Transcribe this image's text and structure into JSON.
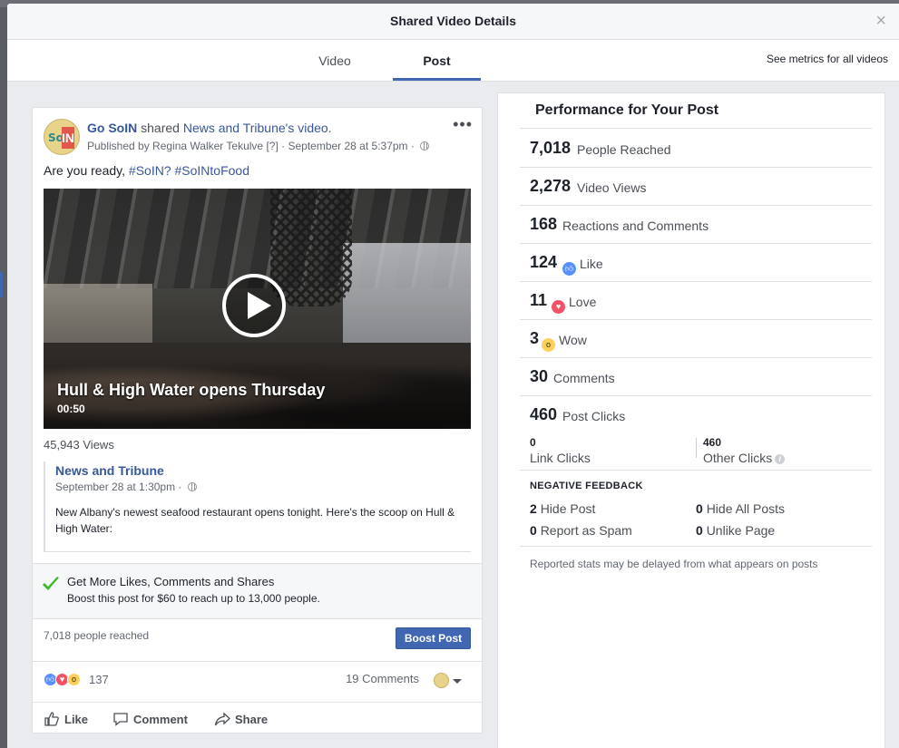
{
  "dialog": {
    "title": "Shared Video Details",
    "close": "×",
    "tabs": [
      {
        "label": "Video"
      },
      {
        "label": "Post",
        "active": true
      }
    ],
    "see_metrics": "See metrics for all videos"
  },
  "post": {
    "page_name": "Go SoIN",
    "shared_text": "shared",
    "source_name": "News and Tribune",
    "source_suffix": "'s video.",
    "published_by": "Published by Regina Walker Tekulve",
    "published_help": "[?]",
    "published_date": "· September 28 at 5:37pm ·",
    "message_prefix": "Are you ready,",
    "hashtag1": "#SoIN?",
    "hashtag2": "#SoINtoFood",
    "video": {
      "title": "Hull & High Water opens Thursday",
      "duration": "00:50"
    },
    "views": "45,943 Views",
    "original": {
      "name": "News and Tribune",
      "date": "September 28 at 1:30pm ·",
      "description": "New Albany's newest seafood restaurant opens tonight. Here's the scoop on Hull & High Water:"
    },
    "boost_promo": {
      "title": "Get More Likes, Comments and Shares",
      "subtitle": "Boost this post for $60 to reach up to 13,000 people."
    },
    "reached": "7,018 people reached",
    "boost_button": "Boost Post",
    "reactions_count": "137",
    "comments_count": "19 Comments",
    "actions": {
      "like": "Like",
      "comment": "Comment",
      "share": "Share"
    }
  },
  "performance": {
    "title": "Performance for Your Post",
    "metrics": [
      {
        "value": "7,018",
        "label": "People Reached"
      },
      {
        "value": "2,278",
        "label": "Video Views"
      },
      {
        "value": "168",
        "label": "Reactions and Comments"
      },
      {
        "value": "124",
        "label": "Like",
        "icon": "like-icon"
      },
      {
        "value": "11",
        "label": "Love",
        "icon": "love-icon"
      },
      {
        "value": "3",
        "label": "Wow",
        "icon": "wow-icon"
      },
      {
        "value": "30",
        "label": "Comments"
      },
      {
        "value": "460",
        "label": "Post Clicks"
      }
    ],
    "link_clicks": {
      "value": "0",
      "label": "Link Clicks"
    },
    "other_clicks": {
      "value": "460",
      "label": "Other Clicks"
    },
    "negative": {
      "title": "NEGATIVE FEEDBACK",
      "hide_post": {
        "value": "2",
        "label": "Hide Post"
      },
      "hide_all": {
        "value": "0",
        "label": "Hide All Posts"
      },
      "report_spam": {
        "value": "0",
        "label": "Report as Spam"
      },
      "unlike_page": {
        "value": "0",
        "label": "Unlike Page"
      }
    },
    "note": "Reported stats may be delayed from what appears on posts"
  },
  "colors": {
    "accent": "#4267b2",
    "link": "#365899",
    "like": "#5890ff",
    "love": "#f25268",
    "wow": "#fcd05a",
    "check": "#42b72a"
  }
}
